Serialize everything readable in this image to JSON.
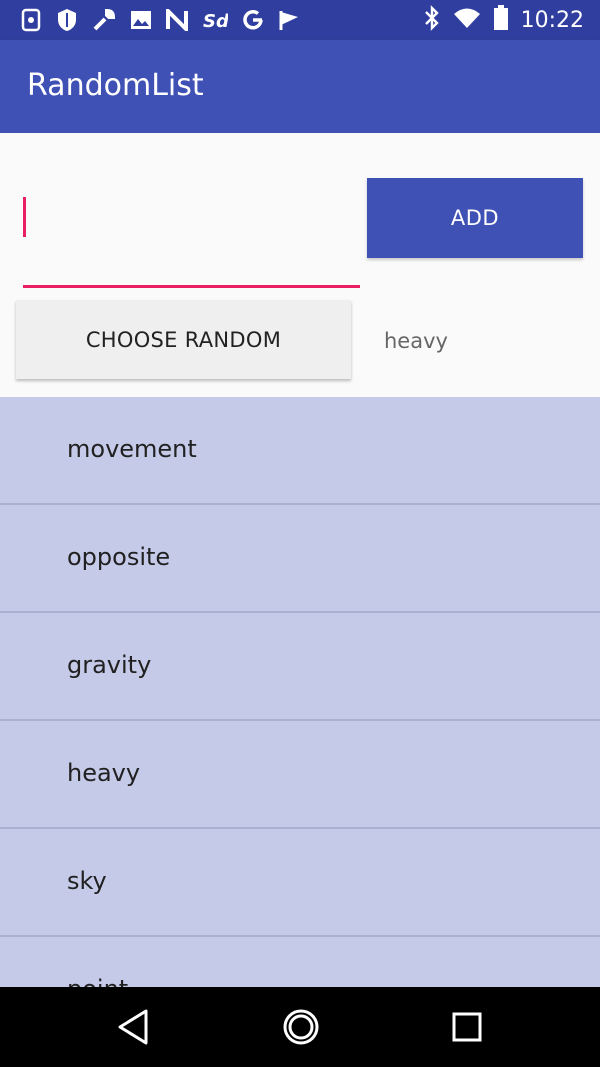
{
  "status_bar": {
    "time": "10:22",
    "left_icons": [
      "phone-icon",
      "shield-icon",
      "wrench-icon",
      "image-icon",
      "n-icon",
      "sd-card-icon",
      "google-icon",
      "check-flag-icon"
    ],
    "right_icons": [
      "bluetooth-icon",
      "wifi-icon",
      "battery-icon"
    ]
  },
  "app_bar": {
    "title": "RandomList",
    "color": "#3F51B5"
  },
  "form": {
    "input_value": "",
    "input_placeholder": "",
    "add_label": "ADD",
    "choose_label": "CHOOSE RANDOM",
    "result": "heavy"
  },
  "list": {
    "items": [
      {
        "label": "movement"
      },
      {
        "label": "opposite"
      },
      {
        "label": "gravity"
      },
      {
        "label": "heavy"
      },
      {
        "label": "sky"
      },
      {
        "label": "point"
      }
    ],
    "background": "#C5CAE9"
  },
  "nav_bar": {
    "icons": [
      "back-icon",
      "home-icon",
      "recents-icon"
    ]
  },
  "colors": {
    "accent": "#E91E63",
    "primary_dark": "#303F9F"
  }
}
